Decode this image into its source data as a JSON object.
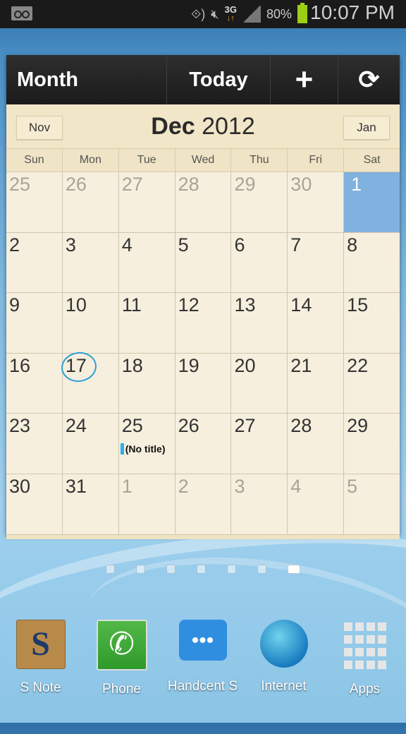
{
  "status_bar": {
    "voicemail_icon": "voicemail-icon",
    "icons": [
      "nfc-icon",
      "mute-icon",
      "3g-data-icon",
      "signal-icon"
    ],
    "network": "3G",
    "battery": "80%",
    "time": "10:07 PM",
    "battery_color": "#9ccf14"
  },
  "toolbar": {
    "view_label": "Month",
    "today_label": "Today",
    "add_glyph": "+",
    "refresh_glyph": "⟳"
  },
  "header": {
    "prev_label": "Nov",
    "next_label": "Jan",
    "month": "Dec",
    "year": "2012"
  },
  "weekdays": [
    "Sun",
    "Mon",
    "Tue",
    "Wed",
    "Thu",
    "Fri",
    "Sat"
  ],
  "weeks": [
    [
      {
        "d": "25",
        "other": true
      },
      {
        "d": "26",
        "other": true
      },
      {
        "d": "27",
        "other": true
      },
      {
        "d": "28",
        "other": true
      },
      {
        "d": "29",
        "other": true
      },
      {
        "d": "30",
        "other": true
      },
      {
        "d": "1",
        "selected": true
      }
    ],
    [
      {
        "d": "2"
      },
      {
        "d": "3"
      },
      {
        "d": "4"
      },
      {
        "d": "5"
      },
      {
        "d": "6"
      },
      {
        "d": "7"
      },
      {
        "d": "8"
      }
    ],
    [
      {
        "d": "9"
      },
      {
        "d": "10"
      },
      {
        "d": "11"
      },
      {
        "d": "12"
      },
      {
        "d": "13"
      },
      {
        "d": "14"
      },
      {
        "d": "15"
      }
    ],
    [
      {
        "d": "16"
      },
      {
        "d": "17",
        "today": true
      },
      {
        "d": "18"
      },
      {
        "d": "19"
      },
      {
        "d": "20"
      },
      {
        "d": "21"
      },
      {
        "d": "22"
      }
    ],
    [
      {
        "d": "23"
      },
      {
        "d": "24"
      },
      {
        "d": "25",
        "event": "(No title)"
      },
      {
        "d": "26"
      },
      {
        "d": "27"
      },
      {
        "d": "28"
      },
      {
        "d": "29"
      }
    ],
    [
      {
        "d": "30"
      },
      {
        "d": "31"
      },
      {
        "d": "1",
        "other": true
      },
      {
        "d": "2",
        "other": true
      },
      {
        "d": "3",
        "other": true
      },
      {
        "d": "4",
        "other": true
      },
      {
        "d": "5",
        "other": true
      }
    ]
  ],
  "colors": {
    "selected_day": "#7fb2de",
    "event_bar": "#2ab0ee",
    "today_circle": "#2a9fd6"
  },
  "home_pages": {
    "count": 7,
    "active_index": 6
  },
  "dock": [
    {
      "label": "S Note",
      "icon": "s-note-icon",
      "glyph": "S"
    },
    {
      "label": "Phone",
      "icon": "phone-icon",
      "glyph": "✆"
    },
    {
      "label": "Handcent S",
      "icon": "messaging-icon",
      "glyph": "•••"
    },
    {
      "label": "Internet",
      "icon": "globe-icon",
      "glyph": ""
    },
    {
      "label": "Apps",
      "icon": "apps-grid-icon",
      "glyph": ""
    }
  ]
}
